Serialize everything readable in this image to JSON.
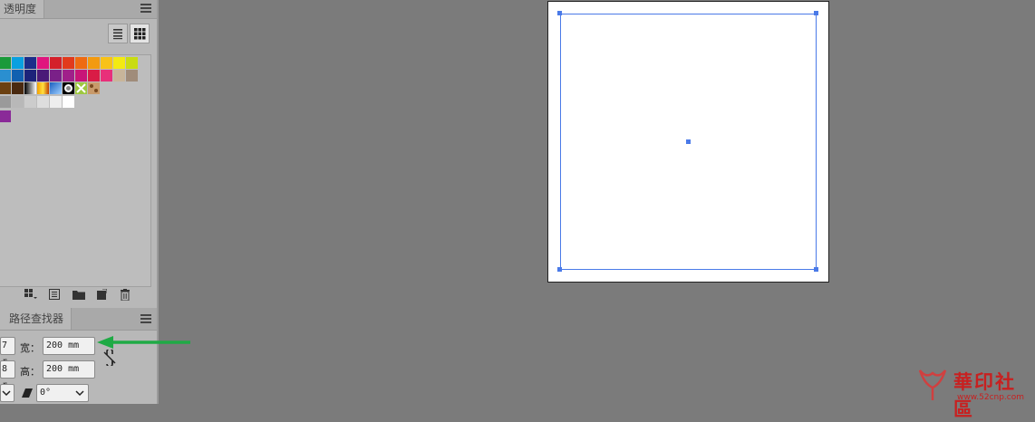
{
  "panels": {
    "transparency_tab": "透明度",
    "pathfinder_tab": "路径查找器"
  },
  "swatches": {
    "row1": [
      "#1a9a3a",
      "#0aa0e0",
      "#1c2e8a",
      "#e0157e",
      "#d4202a",
      "#e23a1c",
      "#ef6b12",
      "#f39a10",
      "#f8c218",
      "#f3ea12",
      "#c9dc12"
    ],
    "row2": [
      "#2a8fd0",
      "#1160b0",
      "#1c237a",
      "#4a1a78",
      "#7a2088",
      "#a0208a",
      "#c81578",
      "#d91c46",
      "#e8307a",
      "#c8b59a",
      "#a08c7a"
    ],
    "row3": [
      "#6b4010",
      "#4a2a10"
    ],
    "row4": [
      "#9a9a9a",
      "#b8b8b8",
      "#cccccc",
      "#dddddd",
      "#eeeeee",
      "#ffffff"
    ],
    "row5": [
      "#8a2a98"
    ]
  },
  "transform": {
    "x_partial": "7 r",
    "y_partial": "8 r",
    "width_label": "宽：",
    "width_value": "200 mm",
    "height_label": "高：",
    "height_value": "200 mm",
    "shear_value": "0°"
  },
  "watermark": {
    "text": "華印社區",
    "url": "www.52cnp.com"
  },
  "colors": {
    "selection": "#4a7ae8",
    "arrow": "#1faa45"
  }
}
